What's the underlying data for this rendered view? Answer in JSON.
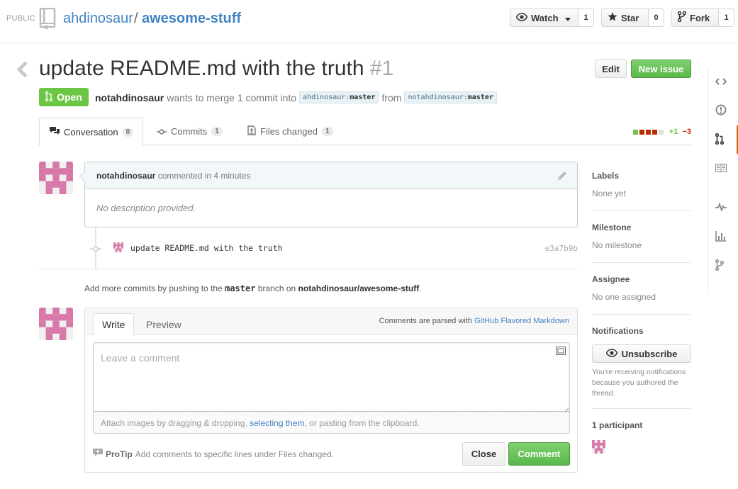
{
  "header": {
    "visibility": "PUBLIC",
    "owner": "ahdinosaur",
    "separator": "/",
    "repo": "awesome-stuff",
    "watch_label": "Watch",
    "watch_count": "1",
    "star_label": "Star",
    "star_count": "0",
    "fork_label": "Fork",
    "fork_count": "1"
  },
  "pr": {
    "title": "update README.md with the truth",
    "number": "#1",
    "edit_label": "Edit",
    "new_issue_label": "New issue",
    "state": "Open",
    "author": "notahdinosaur",
    "merge_text": "wants to merge 1 commit into",
    "base_owner": "ahdinosaur",
    "base_branch": "master",
    "from_text": "from",
    "head_owner": "notahdinosaur",
    "head_branch": "master"
  },
  "tabs": [
    {
      "label": "Conversation",
      "count": "0"
    },
    {
      "label": "Commits",
      "count": "1"
    },
    {
      "label": "Files changed",
      "count": "1"
    }
  ],
  "diffstat": {
    "additions": "+1",
    "deletions": "−3"
  },
  "comment": {
    "author": "notahdinosaur",
    "meta": "commented in 4 minutes",
    "body": "No description provided."
  },
  "commit": {
    "message": "update README.md with the truth",
    "sha": "e3a7b9b"
  },
  "push_hint": {
    "prefix": "Add more commits by pushing to the",
    "branch": "master",
    "middle": "branch on",
    "repo": "notahdinosaur/awesome-stuff",
    "suffix": "."
  },
  "form": {
    "write_tab": "Write",
    "preview_tab": "Preview",
    "md_prefix": "Comments are parsed with",
    "md_link": "GitHub Flavored Markdown",
    "placeholder": "Leave a comment",
    "drop_prefix": "Attach images by dragging & dropping,",
    "drop_link": "selecting them",
    "drop_suffix": ", or pasting from the clipboard.",
    "protip_label": "ProTip",
    "protip_text": "Add comments to specific lines under Files changed.",
    "close_label": "Close",
    "comment_label": "Comment"
  },
  "sidebar": {
    "labels_title": "Labels",
    "labels_value": "None yet",
    "milestone_title": "Milestone",
    "milestone_value": "No milestone",
    "assignee_title": "Assignee",
    "assignee_value": "No one assigned",
    "notifications_title": "Notifications",
    "unsubscribe_label": "Unsubscribe",
    "notifications_note": "You're receiving notifications because you authored the thread.",
    "participants_title": "1 participant"
  },
  "colors": {
    "link": "#4183c4",
    "open_green": "#6cc644",
    "active_nav": "#d26911",
    "addition": "#6cc644",
    "deletion": "#bd2c00"
  },
  "right_nav_icons": [
    "code-icon",
    "issue-icon",
    "pull-request-icon",
    "wiki-icon",
    "pulse-icon",
    "graph-icon",
    "network-icon"
  ]
}
